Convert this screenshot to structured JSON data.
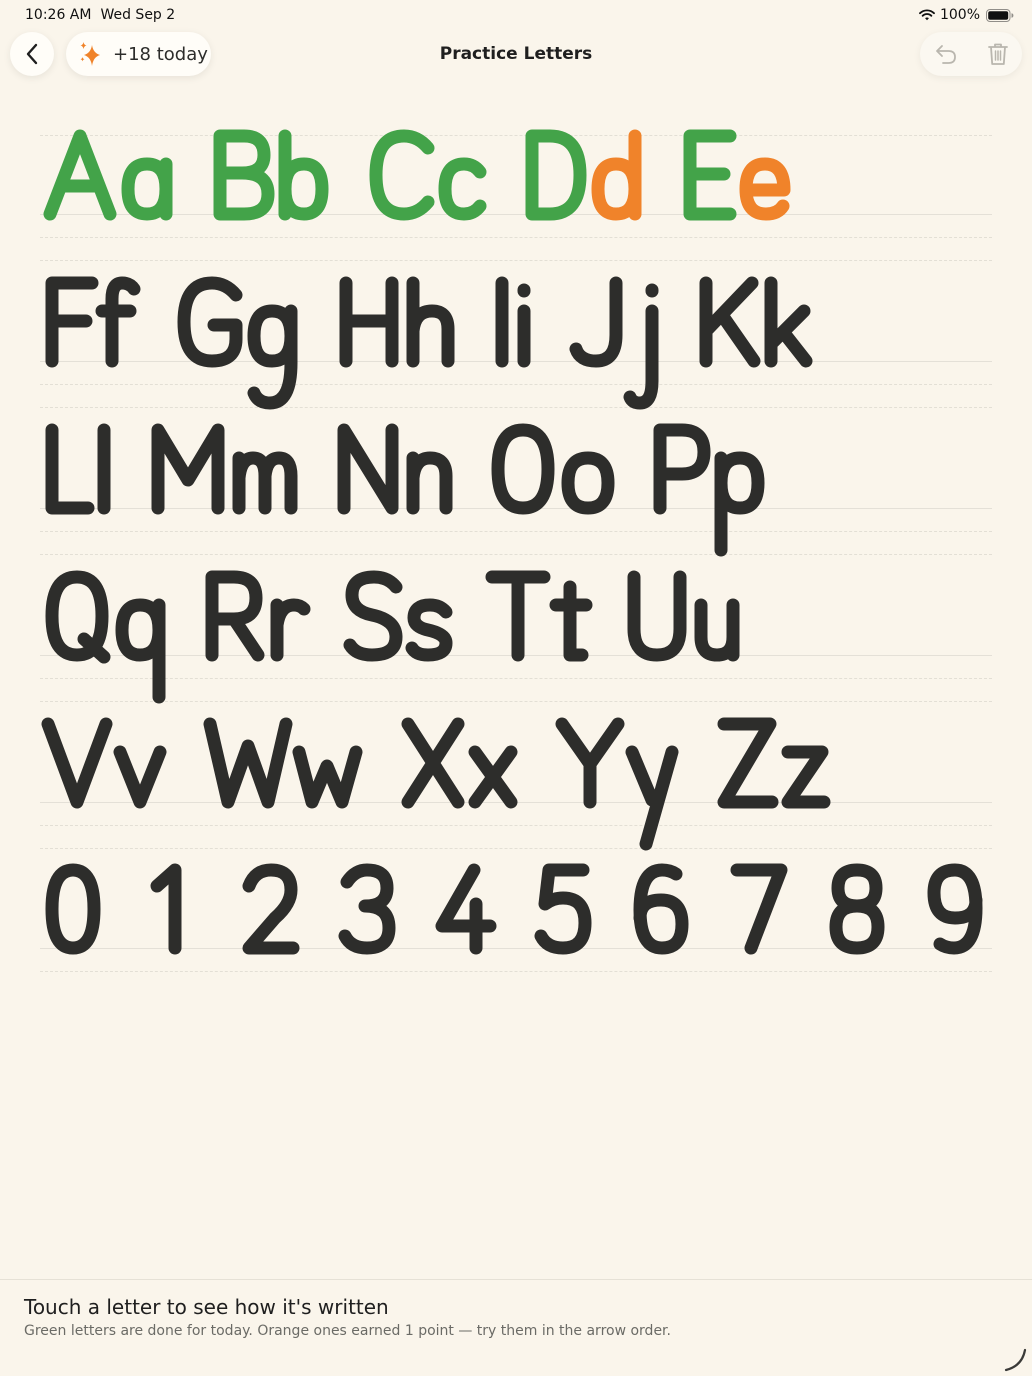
{
  "status_bar": {
    "time": "10:26 AM",
    "date": "Wed Sep 2",
    "battery": "100%"
  },
  "header": {
    "back_icon": "chevron-left-icon",
    "today_badge": {
      "icon": "sparkles-icon",
      "label": "+18 today"
    },
    "title": "Practice Letters",
    "undo_icon": "undo-icon",
    "trash_icon": "trash-icon"
  },
  "colors": {
    "done": "#43a349",
    "partial": "#f0832a",
    "todo": "#2d2d2b",
    "background": "#faf5eb"
  },
  "letter_rows": [
    [
      {
        "upper": "A",
        "lower": "a",
        "upper_status": "done",
        "lower_status": "done"
      },
      {
        "upper": "B",
        "lower": "b",
        "upper_status": "done",
        "lower_status": "done"
      },
      {
        "upper": "C",
        "lower": "c",
        "upper_status": "done",
        "lower_status": "done"
      },
      {
        "upper": "D",
        "lower": "d",
        "upper_status": "done",
        "lower_status": "partial"
      },
      {
        "upper": "E",
        "lower": "e",
        "upper_status": "done",
        "lower_status": "partial"
      }
    ],
    [
      {
        "upper": "F",
        "lower": "f",
        "upper_status": "todo",
        "lower_status": "todo"
      },
      {
        "upper": "G",
        "lower": "g",
        "upper_status": "todo",
        "lower_status": "todo"
      },
      {
        "upper": "H",
        "lower": "h",
        "upper_status": "todo",
        "lower_status": "todo"
      },
      {
        "upper": "I",
        "lower": "i",
        "upper_status": "todo",
        "lower_status": "todo"
      },
      {
        "upper": "J",
        "lower": "j",
        "upper_status": "todo",
        "lower_status": "todo"
      },
      {
        "upper": "K",
        "lower": "k",
        "upper_status": "todo",
        "lower_status": "todo"
      }
    ],
    [
      {
        "upper": "L",
        "lower": "l",
        "upper_status": "todo",
        "lower_status": "todo"
      },
      {
        "upper": "M",
        "lower": "m",
        "upper_status": "todo",
        "lower_status": "todo"
      },
      {
        "upper": "N",
        "lower": "n",
        "upper_status": "todo",
        "lower_status": "todo"
      },
      {
        "upper": "O",
        "lower": "o",
        "upper_status": "todo",
        "lower_status": "todo"
      },
      {
        "upper": "P",
        "lower": "p",
        "upper_status": "todo",
        "lower_status": "todo"
      }
    ],
    [
      {
        "upper": "Q",
        "lower": "q",
        "upper_status": "todo",
        "lower_status": "todo"
      },
      {
        "upper": "R",
        "lower": "r",
        "upper_status": "todo",
        "lower_status": "todo"
      },
      {
        "upper": "S",
        "lower": "s",
        "upper_status": "todo",
        "lower_status": "todo"
      },
      {
        "upper": "T",
        "lower": "t",
        "upper_status": "todo",
        "lower_status": "todo"
      },
      {
        "upper": "U",
        "lower": "u",
        "upper_status": "todo",
        "lower_status": "todo"
      }
    ],
    [
      {
        "upper": "V",
        "lower": "v",
        "upper_status": "todo",
        "lower_status": "todo"
      },
      {
        "upper": "W",
        "lower": "w",
        "upper_status": "todo",
        "lower_status": "todo"
      },
      {
        "upper": "X",
        "lower": "x",
        "upper_status": "todo",
        "lower_status": "todo"
      },
      {
        "upper": "Y",
        "lower": "y",
        "upper_status": "todo",
        "lower_status": "todo"
      },
      {
        "upper": "Z",
        "lower": "z",
        "upper_status": "todo",
        "lower_status": "todo"
      }
    ]
  ],
  "digits": [
    {
      "char": "0",
      "status": "todo"
    },
    {
      "char": "1",
      "status": "todo"
    },
    {
      "char": "2",
      "status": "todo"
    },
    {
      "char": "3",
      "status": "todo"
    },
    {
      "char": "4",
      "status": "todo"
    },
    {
      "char": "5",
      "status": "todo"
    },
    {
      "char": "6",
      "status": "todo"
    },
    {
      "char": "7",
      "status": "todo"
    },
    {
      "char": "8",
      "status": "todo"
    },
    {
      "char": "9",
      "status": "todo"
    }
  ],
  "bottom": {
    "title": "Touch a letter to see how it's written",
    "hint": "Green letters are done for today. Orange ones earned 1 point — try them in the arrow order.",
    "resize_icon": "resize-handle-icon"
  }
}
